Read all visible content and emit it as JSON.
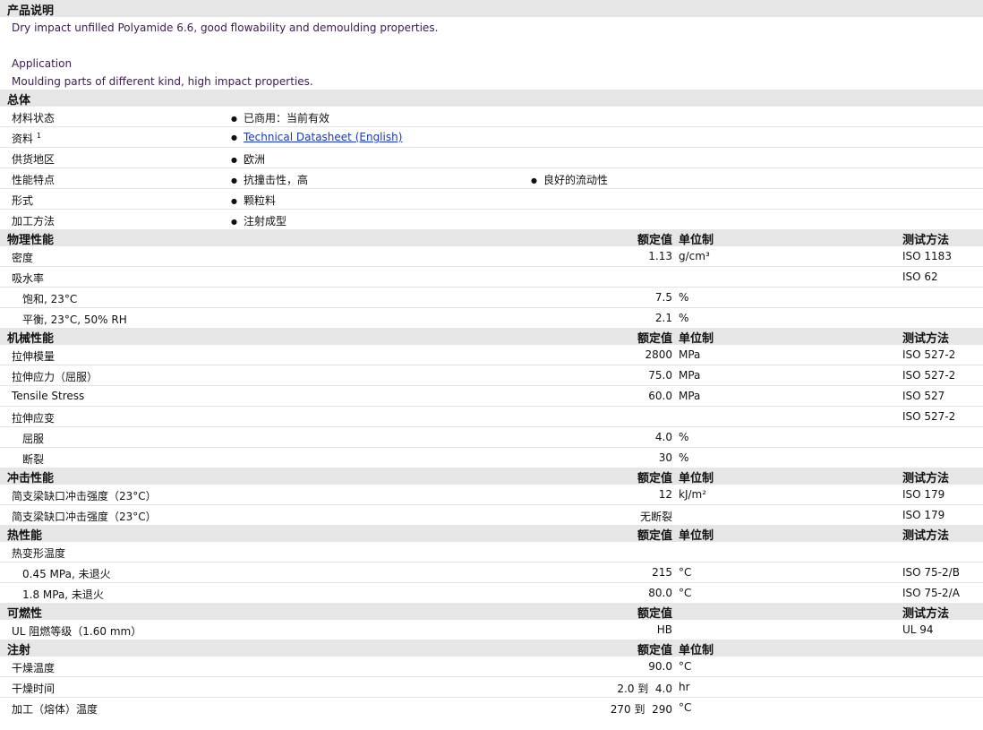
{
  "sections": {
    "desc": "产品说明",
    "general": "总体",
    "physical": "物理性能",
    "mechanical": "机械性能",
    "impact": "冲击性能",
    "thermal": "热性能",
    "flammability": "可燃性",
    "injection": "注射"
  },
  "col": {
    "value": "额定值",
    "unit": "单位制",
    "method": "测试方法"
  },
  "description": {
    "line1": "Dry impact unfilled Polyamide 6.6, good flowability and demoulding properties.",
    "line2": "Application",
    "line3": "Moulding parts of different kind, high impact properties."
  },
  "general": {
    "status_label": "材料状态",
    "status_value": "已商用：当前有效",
    "doc_label": "资料",
    "doc_sup": "1",
    "doc_link": "Technical Datasheet (English)",
    "region_label": "供货地区",
    "region_value": "欧洲",
    "feature_label": "性能特点",
    "feature_1": "抗撞击性，高",
    "feature_2": "良好的流动性",
    "form_label": "形式",
    "form_value": "颗粒料",
    "process_label": "加工方法",
    "process_value": "注射成型"
  },
  "physical": {
    "density": {
      "label": "密度",
      "value": "1.13",
      "unit": "g/cm³",
      "method": "ISO 1183"
    },
    "absorption": {
      "label": "吸水率",
      "method": "ISO 62"
    },
    "sat": {
      "label": "饱和, 23°C",
      "value": "7.5",
      "unit": "%"
    },
    "eq": {
      "label": "平衡, 23°C, 50% RH",
      "value": "2.1",
      "unit": "%"
    }
  },
  "mechanical": {
    "modulus": {
      "label": "拉伸模量",
      "value": "2800",
      "unit": "MPa",
      "method": "ISO 527-2"
    },
    "stress": {
      "label": "拉伸应力（屈服）",
      "value": "75.0",
      "unit": "MPa",
      "method": "ISO 527-2"
    },
    "tensile": {
      "label": "Tensile Stress",
      "value": "60.0",
      "unit": "MPa",
      "method": "ISO 527"
    },
    "strain": {
      "label": "拉伸应变",
      "method": "ISO 527-2"
    },
    "yield": {
      "label": "屈服",
      "value": "4.0",
      "unit": "%"
    },
    "break": {
      "label": "断裂",
      "value": "30",
      "unit": "%"
    }
  },
  "impact": {
    "notched": {
      "label": "简支梁缺口冲击强度（23°C）",
      "value": "12",
      "unit": "kJ/m²",
      "method": "ISO 179"
    },
    "unnotched": {
      "label": "简支梁缺口冲击强度（23°C）",
      "value": "无断裂",
      "method": "ISO 179"
    }
  },
  "thermal": {
    "hdt": {
      "label": "热变形温度"
    },
    "hdt1": {
      "label": "0.45 MPa, 未退火",
      "value": "215",
      "unit": "°C",
      "method": "ISO 75-2/B"
    },
    "hdt2": {
      "label": "1.8 MPa, 未退火",
      "value": "80.0",
      "unit": "°C",
      "method": "ISO 75-2/A"
    }
  },
  "flammability": {
    "ul": {
      "label": "UL 阻燃等级（1.60 mm）",
      "value": "HB",
      "method": "UL 94"
    }
  },
  "injection": {
    "dry_temp": {
      "label": "干燥温度",
      "value": "90.0",
      "unit": "°C"
    },
    "dry_time": {
      "label": "干燥时间",
      "value": "2.0 到  4.0",
      "unit": "hr"
    },
    "melt_temp": {
      "label": "加工（熔体）温度",
      "value": "270 到  290",
      "unit": "°C"
    }
  }
}
